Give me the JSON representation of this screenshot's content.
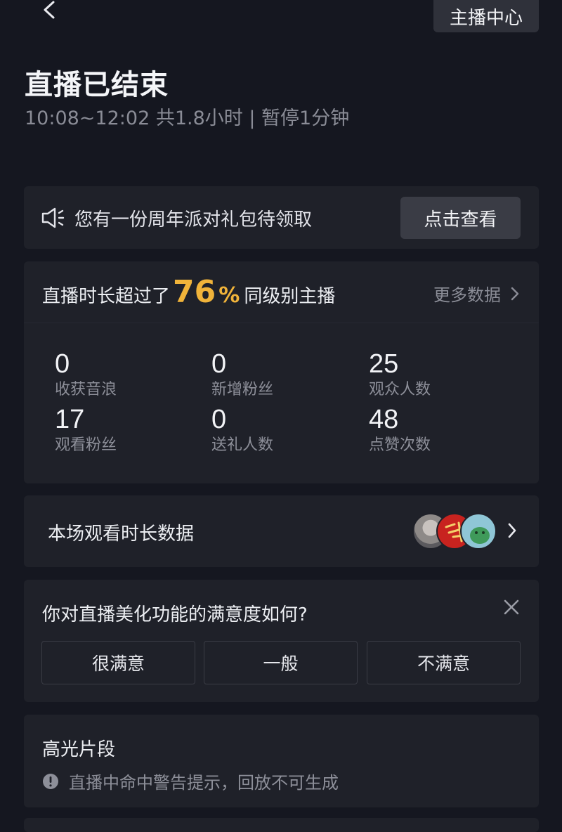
{
  "header": {
    "host_center_label": "主播中心",
    "title": "直播已结束",
    "subtitle": "10:08~12:02 共1.8小时 | 暂停1分钟"
  },
  "gift_banner": {
    "icon": "speaker-icon",
    "text": "您有一份周年派对礼包待领取",
    "button_label": "点击查看"
  },
  "stats": {
    "rank_prefix": "直播时长超过了",
    "rank_percent": "76",
    "rank_percent_sign": "%",
    "rank_suffix": "同级别主播",
    "more_data_label": "更多数据",
    "items": [
      {
        "value": "0",
        "label": "收获音浪"
      },
      {
        "value": "0",
        "label": "新增粉丝"
      },
      {
        "value": "25",
        "label": "观众人数"
      },
      {
        "value": "17",
        "label": "观看粉丝"
      },
      {
        "value": "0",
        "label": "送礼人数"
      },
      {
        "value": "48",
        "label": "点赞次数"
      }
    ]
  },
  "watch_duration": {
    "title": "本场观看时长数据",
    "avatars": [
      "avatar-1",
      "avatar-2",
      "avatar-3"
    ]
  },
  "survey": {
    "question": "你对直播美化功能的满意度如何?",
    "options": [
      "很满意",
      "一般",
      "不满意"
    ]
  },
  "highlights": {
    "title": "高光片段",
    "warning": "直播中命中警告提示，回放不可生成"
  },
  "colors": {
    "background": "#151720",
    "card": "#1f2129",
    "accent": "#f0b33a",
    "muted_text": "#8d8f99"
  }
}
